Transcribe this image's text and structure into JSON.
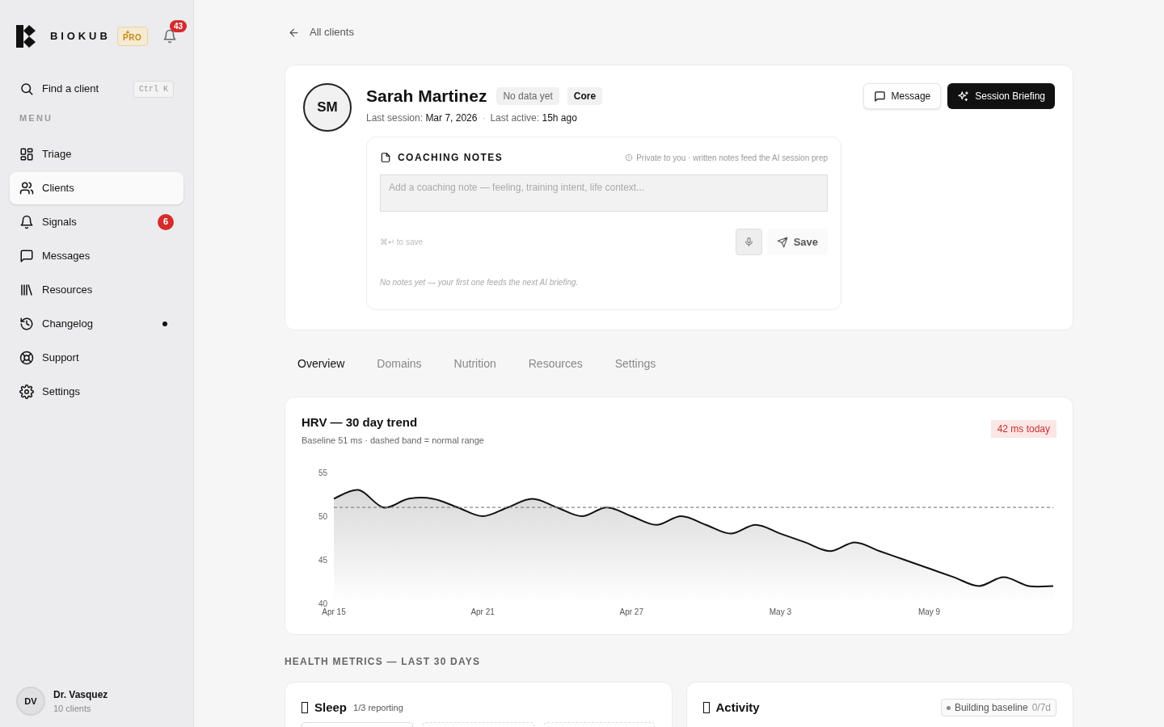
{
  "brand": {
    "name": "BIOKUB",
    "badge": "PRO"
  },
  "notifications": {
    "count": "43"
  },
  "search": {
    "label": "Find a client",
    "shortcut": "Ctrl K"
  },
  "menu_heading": "MENU",
  "nav": [
    {
      "label": "Triage",
      "selected": false,
      "dot": false
    },
    {
      "label": "Clients",
      "selected": true,
      "dot": false
    },
    {
      "label": "Signals",
      "selected": false,
      "badge": "6",
      "dot": false
    },
    {
      "label": "Messages",
      "selected": false,
      "dot": false
    },
    {
      "label": "Resources",
      "selected": false,
      "dot": false
    },
    {
      "label": "Changelog",
      "selected": false,
      "dot": true
    },
    {
      "label": "Support",
      "selected": false,
      "dot": false
    },
    {
      "label": "Settings",
      "selected": false,
      "dot": false
    }
  ],
  "user": {
    "initials": "DV",
    "name": "Dr. Vasquez",
    "subtitle": "10 clients"
  },
  "back_link": "All clients",
  "client": {
    "initials": "SM",
    "name": "Sarah Martinez",
    "tags": [
      {
        "label": "No data yet",
        "kind": "muted"
      },
      {
        "label": "Core",
        "kind": "strong"
      }
    ],
    "last_session_label": "Last session:",
    "last_session": "Mar 7, 2026",
    "last_active_label": "Last active:",
    "last_active": "15h ago",
    "separator": "·",
    "actions": [
      {
        "label": "Message",
        "kind": "secondary"
      },
      {
        "label": "Session Briefing",
        "kind": "primary"
      }
    ]
  },
  "notes": {
    "title": "COACHING NOTES",
    "privacy": "Private to you · written notes feed the AI session prep",
    "placeholder": "Add a coaching note — feeling, training intent, life context...",
    "hint": "⌘↵ to save",
    "save": "Save",
    "empty": "No notes yet — your first one feeds the next AI briefing."
  },
  "tabs": [
    {
      "label": "Overview",
      "selected": true
    },
    {
      "label": "Domains",
      "selected": false
    },
    {
      "label": "Nutrition",
      "selected": false
    },
    {
      "label": "Resources",
      "selected": false
    },
    {
      "label": "Settings",
      "selected": false
    }
  ],
  "hrv": {
    "title": "HRV — 30 day trend",
    "subtitle": "Baseline 51 ms · dashed band = normal range",
    "today": "42 ms today",
    "chart_data": {
      "type": "area",
      "categories": [
        "Apr 15",
        null,
        null,
        null,
        null,
        null,
        "Apr 21",
        null,
        null,
        null,
        null,
        null,
        "Apr 27",
        null,
        null,
        null,
        null,
        null,
        "May 3",
        null,
        null,
        null,
        null,
        null,
        "May 9",
        null,
        null,
        null,
        null,
        null
      ],
      "ylim": [
        40,
        55
      ],
      "yticks": [
        40,
        45,
        50,
        55
      ],
      "series": [
        {
          "color": "#111111",
          "values": [
            52,
            53,
            51,
            52,
            52,
            51,
            50,
            51,
            52,
            51,
            50,
            51,
            50,
            49,
            50,
            49,
            48,
            49,
            48,
            47,
            46,
            47,
            46,
            45,
            44,
            43,
            42,
            43,
            42,
            42
          ]
        },
        {
          "type": "line",
          "line_style": "dashed",
          "color": "#888888",
          "values": [
            51,
            51,
            51,
            51,
            51,
            51,
            51,
            51,
            51,
            51,
            51,
            51,
            51,
            51,
            51,
            51,
            51,
            51,
            51,
            51,
            51,
            51,
            51,
            51,
            51,
            51,
            51,
            51,
            51,
            51
          ]
        }
      ],
      "ylabel": null
    }
  },
  "metrics_heading": "HEALTH METRICS — LAST 30 DAYS",
  "metrics": [
    {
      "title": "Sleep",
      "subtitle": "1/3 reporting",
      "tiles": [
        {
          "reporting": true
        },
        {
          "reporting": false
        },
        {
          "reporting": false
        }
      ]
    },
    {
      "title": "Activity",
      "status": "Building baseline",
      "status_suffix": "0/7d"
    }
  ]
}
